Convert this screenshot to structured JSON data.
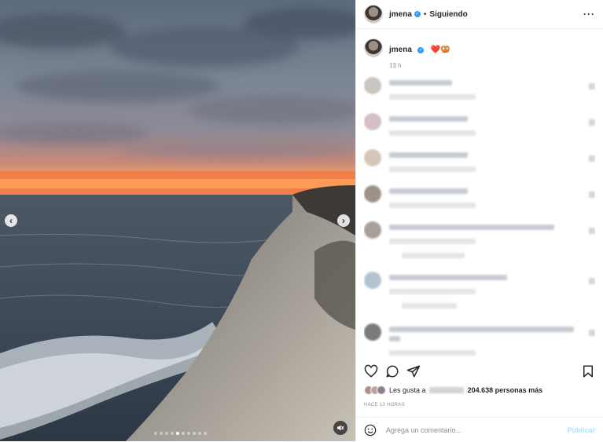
{
  "header": {
    "username": "jmena",
    "separator": "•",
    "follow_status": "Siguiendo",
    "more_label": "···"
  },
  "caption": {
    "username": "jmena",
    "emojis": "❤️🥨",
    "time": "13 h"
  },
  "comments": {
    "count_visible": 8
  },
  "likes": {
    "prefix": "Les gusta a",
    "count_text": "204.638 personas más"
  },
  "post_date": "HACE 13 HORAS",
  "add_comment": {
    "placeholder": "Agrega un comentario...",
    "publish_label": "Publicar"
  },
  "carousel": {
    "slides": 10,
    "active_index": 4
  },
  "colors": {
    "verified": "#3897f0",
    "publish_disabled": "#b2dffc",
    "secondary_text": "#8e8e8e"
  }
}
